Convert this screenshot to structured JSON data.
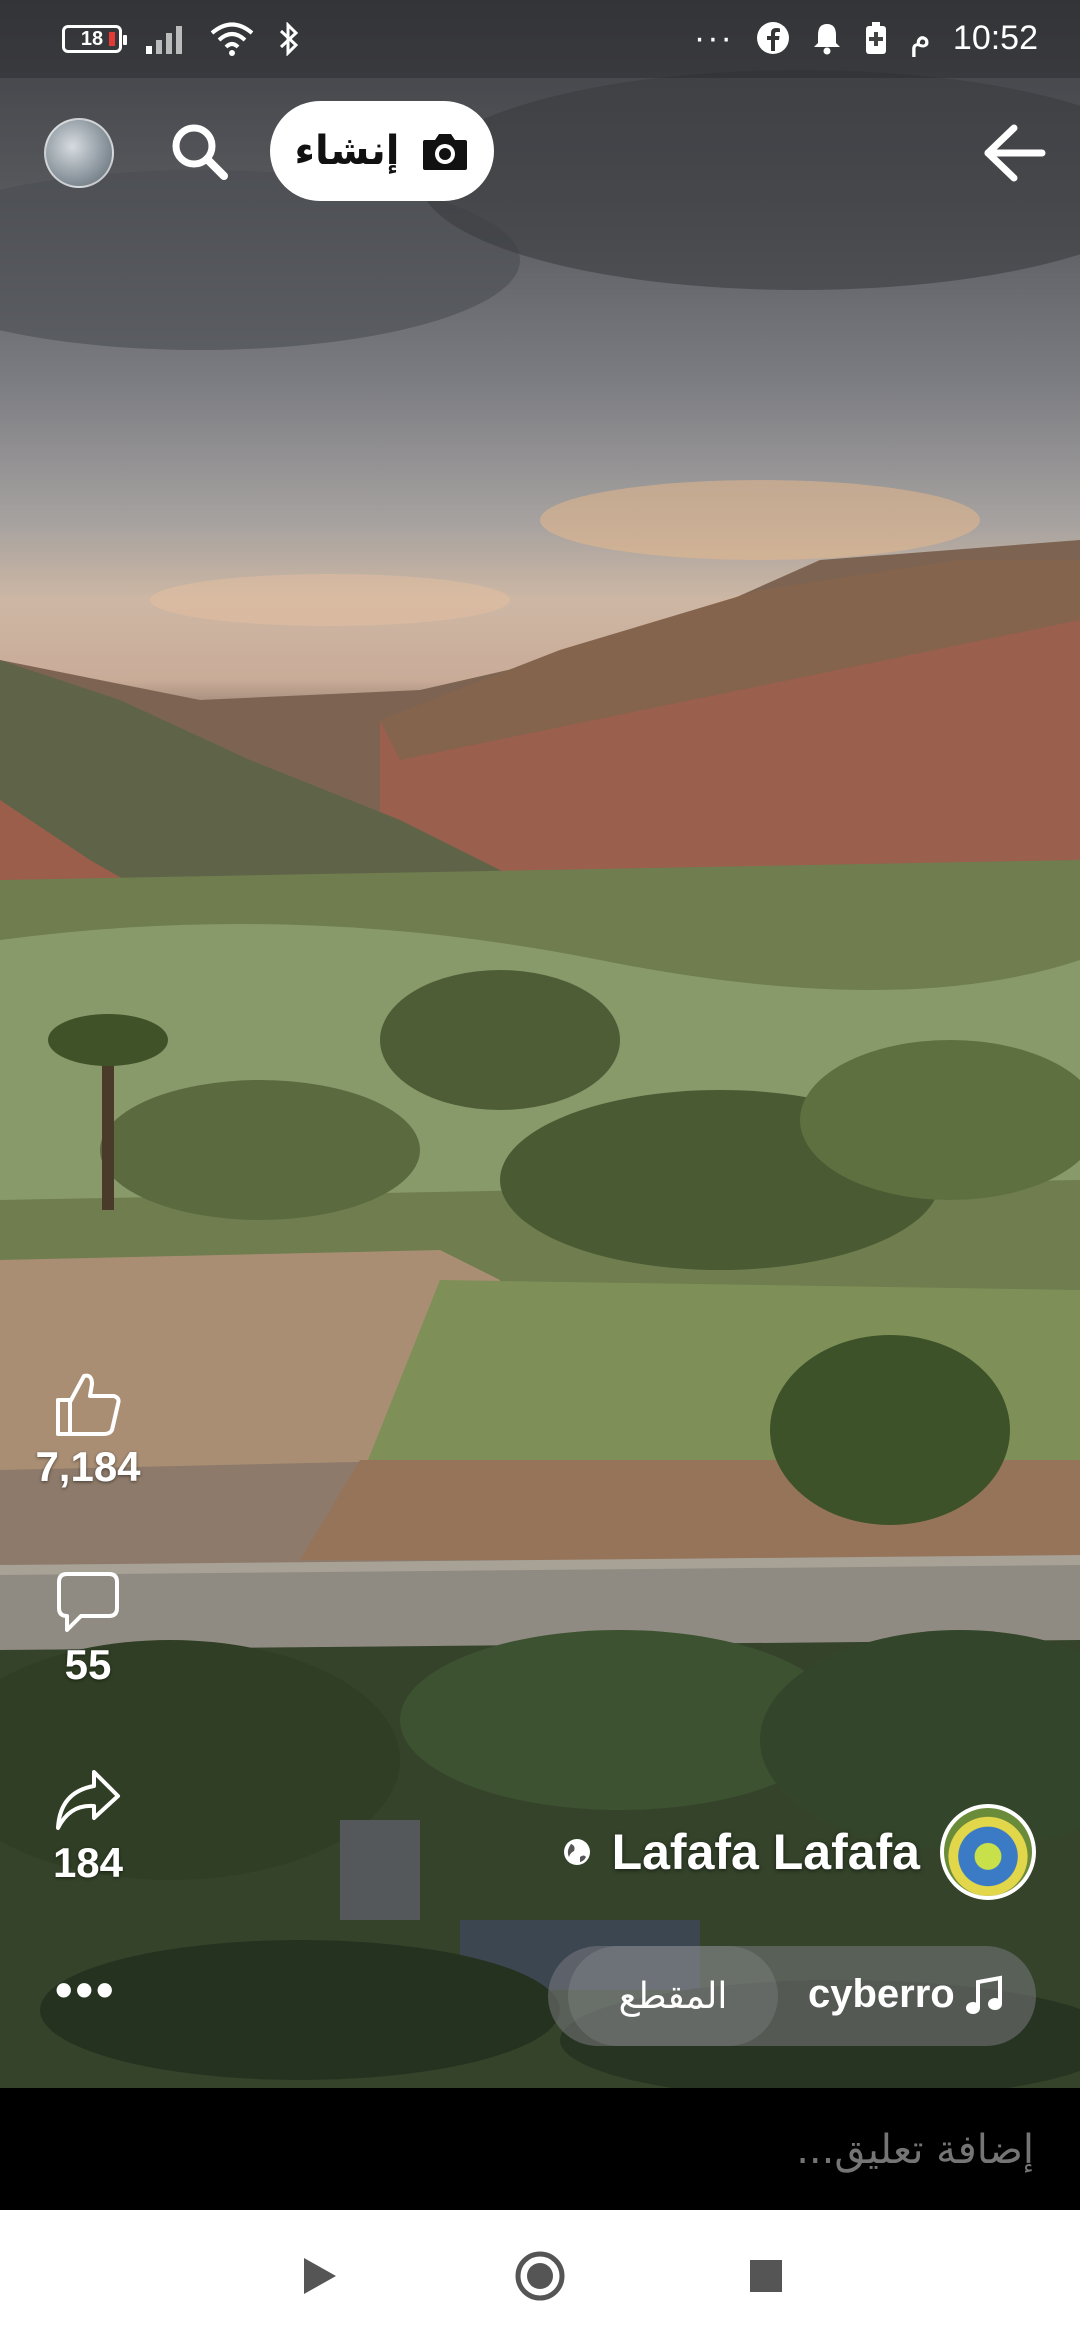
{
  "status_bar": {
    "battery_level": "18",
    "time": "10:52",
    "time_suffix": "م",
    "overflow": "···"
  },
  "top_bar": {
    "create_label": "إنشاء"
  },
  "actions": {
    "likes": "7,184",
    "comments": "55",
    "shares": "184",
    "more": "•••"
  },
  "author": {
    "name": "Lafafa Lafafa"
  },
  "music": {
    "track": "cyberro",
    "clip_label": "المقطع"
  },
  "comment": {
    "placeholder": "إضافة تعليق..."
  },
  "icons": {
    "status": [
      "battery-icon",
      "signal-icon",
      "wifi-icon",
      "bluetooth-icon",
      "facebook-icon",
      "bell-icon",
      "battery-saver-icon"
    ],
    "top": [
      "profile-avatar",
      "search-icon",
      "camera-icon",
      "back-arrow-icon"
    ],
    "actions": [
      "like-icon",
      "comment-icon",
      "share-icon"
    ],
    "nav": [
      "back-triangle-icon",
      "home-circle-icon",
      "recents-square-icon"
    ]
  }
}
